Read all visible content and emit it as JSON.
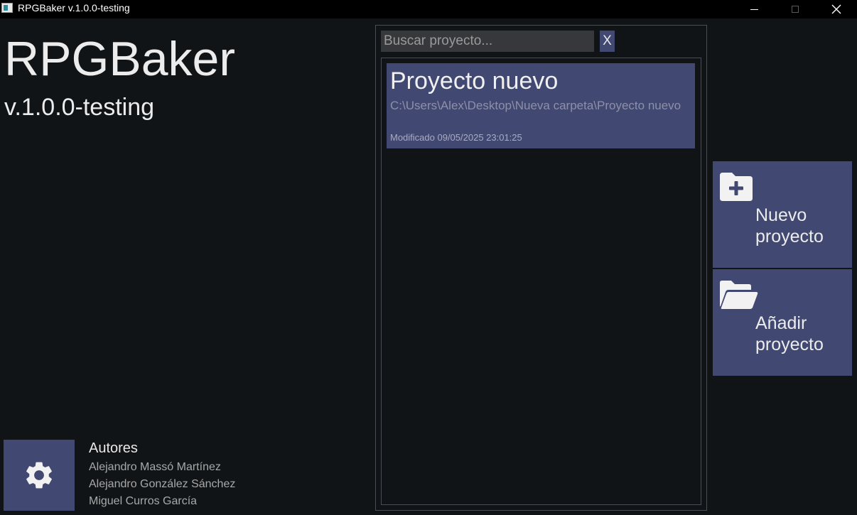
{
  "window": {
    "title": "RPGBaker v.1.0.0-testing"
  },
  "app": {
    "title": "RPGBaker",
    "version": "v.1.0.0-testing"
  },
  "search": {
    "placeholder": "Buscar proyecto...",
    "value": "",
    "clear_label": "X"
  },
  "projects": [
    {
      "name": "Proyecto nuevo",
      "path": "C:\\Users\\Alex\\Desktop\\Nueva carpeta\\Proyecto nuevo",
      "modified": "Modificado 09/05/2025 23:01:25"
    }
  ],
  "actions": {
    "new_project": {
      "line1": "Nuevo",
      "line2": "proyecto",
      "icon": "folder-plus-icon"
    },
    "add_project": {
      "line1": "Añadir",
      "line2": "proyecto",
      "icon": "folder-open-icon"
    }
  },
  "authors": {
    "heading": "Autores",
    "names": [
      "Alejandro Massó Martínez",
      "Alejandro González Sánchez",
      "Miguel Curros García"
    ]
  },
  "colors": {
    "background": "#111417",
    "accent": "#414871",
    "panel_border": "#4a4d52"
  }
}
